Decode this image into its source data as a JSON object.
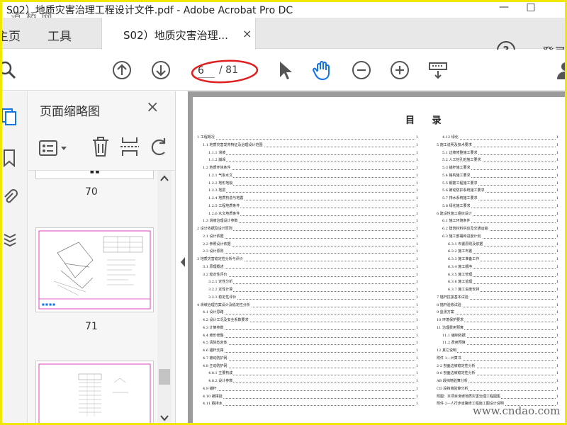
{
  "window": {
    "title": "S02）地质灾害治理工程设计文件.pdf - Adobe Acrobat Pro DC",
    "watermark_top": "道 桥 网",
    "min_icon": "—",
    "max_icon": "□"
  },
  "tabs": {
    "home": "主页",
    "tools": "工具",
    "doc": "S02）地质灾害治理...",
    "close": "×",
    "help": "?",
    "login": "登录"
  },
  "toolbar": {
    "page_current": "6",
    "page_total": "/ 81"
  },
  "panel": {
    "title": "页面缩略图",
    "close": "×",
    "thumb_top_text": "■ ■",
    "thumbs": [
      "70",
      "71"
    ]
  },
  "toc": {
    "title": "目  录",
    "left": [
      {
        "t": "1 工程概况",
        "n": "1",
        "i": 0
      },
      {
        "t": "1.1 地质灾害发育特征及治理设计范围",
        "n": "1",
        "i": 1
      },
      {
        "t": "1.1.1 滑坡",
        "n": "1",
        "i": 2
      },
      {
        "t": "1.1.2 崩塌",
        "n": "1",
        "i": 2
      },
      {
        "t": "1.2 地质环境条件",
        "n": "1",
        "i": 1
      },
      {
        "t": "1.2.1 气象水文",
        "n": "1",
        "i": 2
      },
      {
        "t": "1.2.2 地形地貌",
        "n": "1",
        "i": 2
      },
      {
        "t": "1.2.3 地层",
        "n": "1",
        "i": 2
      },
      {
        "t": "1.2.4 地质构造与地震",
        "n": "1",
        "i": 2
      },
      {
        "t": "1.2.5 工程地质条件",
        "n": "1",
        "i": 2
      },
      {
        "t": "1.2.6 水文地质条件",
        "n": "1",
        "i": 2
      },
      {
        "t": "1.3 滑坡治理设计参数",
        "n": "1",
        "i": 1
      },
      {
        "t": "2 设计依据及设计原则",
        "n": "1",
        "i": 0
      },
      {
        "t": "2.1 设计依据",
        "n": "1",
        "i": 1
      },
      {
        "t": "2.2 参照设计依据",
        "n": "1",
        "i": 1
      },
      {
        "t": "2.3 设计原则",
        "n": "1",
        "i": 1
      },
      {
        "t": "3 地质灾害稳定性分析与评价",
        "n": "1",
        "i": 0
      },
      {
        "t": "3.1 原理概述",
        "n": "1",
        "i": 1
      },
      {
        "t": "3.2 稳定性评价",
        "n": "1",
        "i": 1
      },
      {
        "t": "3.2.1 定性分析",
        "n": "1",
        "i": 2
      },
      {
        "t": "3.2.2 定性计算",
        "n": "1",
        "i": 2
      },
      {
        "t": "3.2.3 稳定性评价",
        "n": "1",
        "i": 2
      },
      {
        "t": "4 滑坡治理方案设计及稳定性分析",
        "n": "1",
        "i": 0
      },
      {
        "t": "4.1 设计思路",
        "n": "1",
        "i": 1
      },
      {
        "t": "4.2 设计工况及安全系数要求",
        "n": "1",
        "i": 1
      },
      {
        "t": "4.3 计算参数",
        "n": "1",
        "i": 1
      },
      {
        "t": "4.4 坡形修整",
        "n": "1",
        "i": 1
      },
      {
        "t": "4.5 清除危岩体",
        "n": "1",
        "i": 1
      },
      {
        "t": "4.6 锚杆支撑",
        "n": "1",
        "i": 1
      },
      {
        "t": "4.7 被动防护网",
        "n": "1",
        "i": 1
      },
      {
        "t": "4.8 主动防护网",
        "n": "1",
        "i": 1
      },
      {
        "t": "4.8.1 主要构成",
        "n": "1",
        "i": 2
      },
      {
        "t": "4.8.2 设计参数",
        "n": "1",
        "i": 2
      },
      {
        "t": "4.9 锚杆",
        "n": "1",
        "i": 1
      },
      {
        "t": "4.10 被撑挂",
        "n": "1",
        "i": 1
      },
      {
        "t": "4.11 截排水",
        "n": "1",
        "i": 1
      }
    ],
    "right": [
      {
        "t": "4.12 绿化",
        "n": "1",
        "i": 1
      },
      {
        "t": "5 施工说明及技术要求",
        "n": "1",
        "i": 0
      },
      {
        "t": "5.1 边坡修整施工要求",
        "n": "1",
        "i": 1
      },
      {
        "t": "5.2 人工挖孔桩施工要求",
        "n": "1",
        "i": 1
      },
      {
        "t": "5.3 锚杆施工要求",
        "n": "1",
        "i": 1
      },
      {
        "t": "5.4 格构施工要求",
        "n": "1",
        "i": 1
      },
      {
        "t": "5.5 钢筋工程施工要求",
        "n": "1",
        "i": 1
      },
      {
        "t": "5.6 被动防护系统施工要求",
        "n": "1",
        "i": 1
      },
      {
        "t": "5.7 排水系统施工要求",
        "n": "1",
        "i": 1
      },
      {
        "t": "5.8 绿化施工要求",
        "n": "1",
        "i": 1
      },
      {
        "t": "6 建设性施工组织设计",
        "n": "1",
        "i": 0
      },
      {
        "t": "6.1 施工环境条件",
        "n": "1",
        "i": 1
      },
      {
        "t": "6.2 建筑材料供应及交通运输",
        "n": "1",
        "i": 1
      },
      {
        "t": "6.3 施工部署和进度计划",
        "n": "1",
        "i": 1
      },
      {
        "t": "6.3.1 布置原则及依据",
        "n": "1",
        "i": 2
      },
      {
        "t": "6.3.2 施工布置",
        "n": "1",
        "i": 2
      },
      {
        "t": "6.3.3 施工准备工作",
        "n": "1",
        "i": 2
      },
      {
        "t": "6.3.4 施工顺序",
        "n": "1",
        "i": 2
      },
      {
        "t": "6.3.5 施工管理",
        "n": "1",
        "i": 2
      },
      {
        "t": "6.3.6 施工监理",
        "n": "1",
        "i": 2
      },
      {
        "t": "6.3.7 施工进度安排",
        "n": "1",
        "i": 2
      },
      {
        "t": "7 锚杆抗拔基本试验",
        "n": "1",
        "i": 0
      },
      {
        "t": "8 锚杆验收试验",
        "n": "1",
        "i": 0
      },
      {
        "t": "9 监测方案",
        "n": "1",
        "i": 0
      },
      {
        "t": "10 环境保护要求",
        "n": "1",
        "i": 0
      },
      {
        "t": "11 治理费用预算",
        "n": "1",
        "i": 0
      },
      {
        "t": "11.1 编制依据",
        "n": "1",
        "i": 1
      },
      {
        "t": "11.2 费用预算",
        "n": "1",
        "i": 1
      },
      {
        "t": "12 其它说明",
        "n": "1",
        "i": 0
      },
      {
        "t": "附件 1—计算书",
        "n": "1",
        "i": 0
      },
      {
        "t": "2-2 剖面边坡稳定性分析",
        "n": "1",
        "i": 0
      },
      {
        "t": "8-8 剖面边坡稳定性分析",
        "n": "1",
        "i": 0
      },
      {
        "t": "AB 段挡墙验算分析",
        "n": "1",
        "i": 0
      },
      {
        "t": "CD 段挡墙验算分析",
        "n": "1",
        "i": 0
      },
      {
        "t": "附图：本项目滑坡地质灾害治理工程图集",
        "n": "1",
        "i": 0
      },
      {
        "t": "附件 2—人行步道路修工程施工图设计说明",
        "n": "1",
        "i": 0
      }
    ]
  },
  "watermark_br": "www.cndao.com",
  "colors": {
    "highlight": "#e02020",
    "accent": "#1473e6",
    "frame": "#f0e800",
    "thumb_border": "#e040c0"
  }
}
